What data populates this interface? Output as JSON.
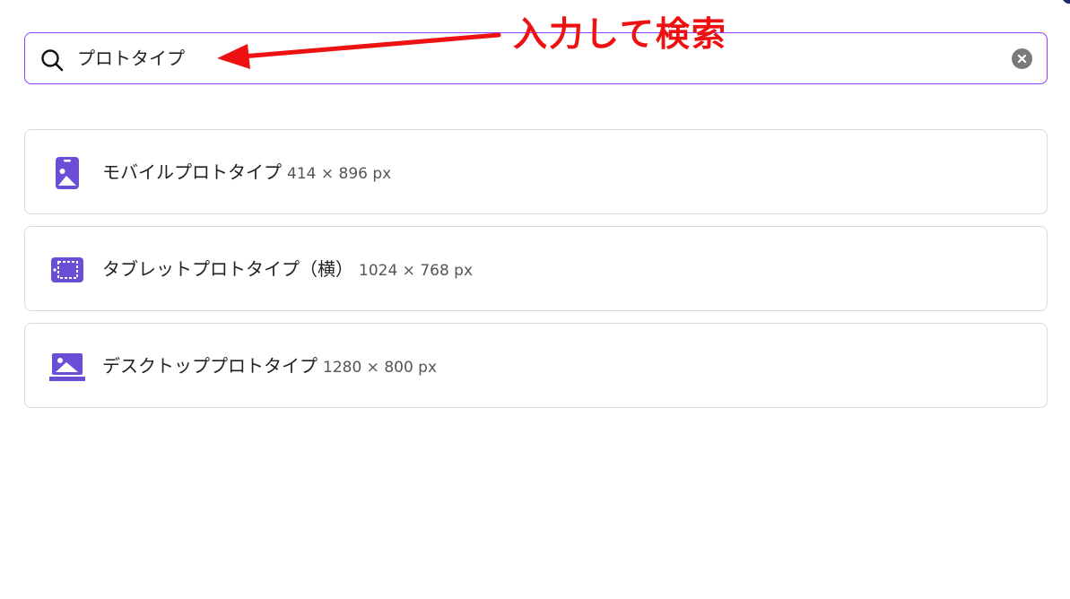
{
  "search": {
    "value": "プロトタイプ"
  },
  "annotation": {
    "text": "入力して検索",
    "color": "#ee1111"
  },
  "accent_color": "#8b3dff",
  "icon_color": "#6a4fd6",
  "results": [
    {
      "icon": "mobile-phone-icon",
      "title": "モバイルプロトタイプ",
      "dims": "414 × 896 px"
    },
    {
      "icon": "tablet-icon",
      "title": "タブレットプロトタイプ（横）",
      "dims": "1024 × 768 px"
    },
    {
      "icon": "desktop-icon",
      "title": "デスクトッププロトタイプ",
      "dims": "1280 × 800 px"
    }
  ]
}
